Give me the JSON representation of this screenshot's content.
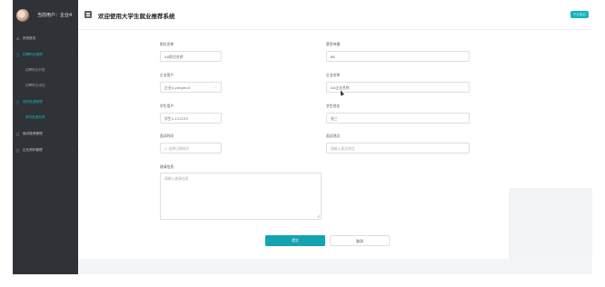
{
  "sidebar": {
    "user_label": "当前用户：企业4",
    "items": [
      {
        "label": "系统首页",
        "icon": "home-icon",
        "active": false
      },
      {
        "label": "招聘职位管理",
        "icon": "document-icon",
        "active": true
      },
      {
        "label": "招聘职位列表",
        "sub": true,
        "active": false
      },
      {
        "label": "招聘职位添加",
        "sub": true,
        "active": false
      },
      {
        "label": "简历投递管理",
        "icon": "document-icon",
        "active": true
      },
      {
        "label": "简历投递列表",
        "sub": true,
        "active": true
      },
      {
        "label": "面试邀请管理",
        "icon": "document-icon",
        "active": false
      },
      {
        "label": "企业资料管理",
        "icon": "document-icon",
        "active": false
      }
    ]
  },
  "header": {
    "title": "欢迎使用大学生就业推荐系统",
    "user_center": "个人中心"
  },
  "form": {
    "job_title_label": "职位名称",
    "job_title_value": "AA职位名称",
    "salary_label": "薪资待遇",
    "salary_value": "8K",
    "company_user_label": "企业用户",
    "company_user_value": "企业4-yonghu4",
    "company_name_label": "企业名称",
    "company_name_value": "AA企业名称",
    "student_user_label": "学生用户",
    "student_user_value": "学生1-112233",
    "student_name_label": "学生姓名",
    "student_name_value": "张三",
    "interview_time_label": "面试时间",
    "interview_time_placeholder": "选择日期时间",
    "interview_place_label": "面试地点",
    "interview_place_placeholder": "请输入面试地点",
    "invitation_label": "邀请信息",
    "invitation_placeholder": "请输入邀请信息",
    "submit_label": "提交",
    "cancel_label": "取消"
  },
  "colors": {
    "accent": "#14b4c0",
    "sidebar_bg": "#2f3237"
  }
}
